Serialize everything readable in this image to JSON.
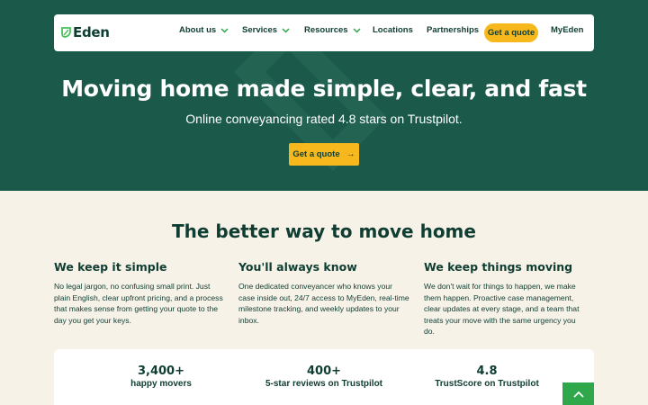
{
  "brand": {
    "name": "Eden",
    "colors": {
      "primary": "#1b5a4b",
      "accent": "#f6b81c",
      "leaf": "#47c25a",
      "cream": "#f7f2e8",
      "scroll_button": "#2ea84a"
    }
  },
  "nav": {
    "items": [
      {
        "label": "About us",
        "has_dropdown": true
      },
      {
        "label": "Services",
        "has_dropdown": true
      },
      {
        "label": "Resources",
        "has_dropdown": true
      },
      {
        "label": "Locations",
        "has_dropdown": false
      },
      {
        "label": "Partnerships",
        "has_dropdown": false
      }
    ],
    "cta_label": "Get a quote",
    "account_label": "MyEden"
  },
  "hero": {
    "title": "Moving home made simple, clear, and fast",
    "subtitle": "Online conveyancing rated 4.8 stars on Trustpilot.",
    "cta_label": "Get a quote",
    "cta_icon": "arrow-right-icon"
  },
  "features": {
    "title": "The better way to move home",
    "items": [
      {
        "heading": "We keep it simple",
        "body": "No legal jargon, no confusing small print. Just plain English, clear upfront pricing, and a process that makes sense from getting your quote to the day you get your keys."
      },
      {
        "heading": "You'll always know",
        "body": "One dedicated conveyancer who knows your case inside out, 24/7 access to MyEden, real-time milestone tracking, and weekly updates to your inbox."
      },
      {
        "heading": "We keep things moving",
        "body": "We don't wait for things to happen, we make them happen. Proactive case management, clear updates at every stage, and a team that treats your move with the same urgency you do."
      }
    ]
  },
  "stats": [
    {
      "value": "3,400+",
      "label": "happy movers"
    },
    {
      "value": "400+",
      "label": "5-star reviews on Trustpilot"
    },
    {
      "value": "4.8",
      "label": "TrustScore on Trustpilot"
    }
  ],
  "scroll_top": {
    "icon": "chevron-up-icon"
  }
}
